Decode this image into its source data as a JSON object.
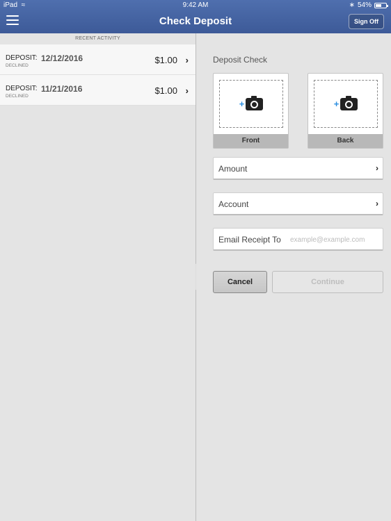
{
  "status_bar": {
    "device": "iPad",
    "time": "9:42 AM",
    "battery": "54%"
  },
  "nav": {
    "title": "Check Deposit",
    "sign_off_label": "Sign Off"
  },
  "recent_activity": {
    "header": "RECENT ACTIVITY",
    "items": [
      {
        "type": "DEPOSIT:",
        "date": "12/12/2016",
        "status": "DECLINED",
        "amount": "$1.00"
      },
      {
        "type": "DEPOSIT:",
        "date": "11/21/2016",
        "status": "DECLINED",
        "amount": "$1.00"
      }
    ]
  },
  "deposit_form": {
    "title": "Deposit Check",
    "front_label": "Front",
    "back_label": "Back",
    "amount_label": "Amount",
    "account_label": "Account",
    "email_label": "Email Receipt To",
    "email_placeholder": "example@example.com",
    "cancel_label": "Cancel",
    "continue_label": "Continue"
  },
  "colors": {
    "nav_bar": "#4464a4",
    "plus_accent": "#2a8ee0"
  },
  "icons": [
    "wifi-icon",
    "bluetooth-icon",
    "battery-icon",
    "menu-icon",
    "camera-icon",
    "plus-icon",
    "chevron-right-icon"
  ]
}
